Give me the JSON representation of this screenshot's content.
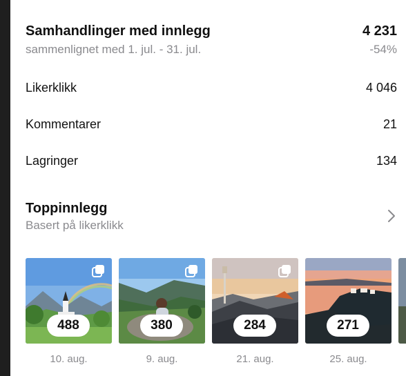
{
  "summary": {
    "title": "Samhandlinger med innlegg",
    "total": "4 231",
    "comparison_text": "sammenlignet med 1. jul. - 31. jul.",
    "change": "-54%"
  },
  "metrics": [
    {
      "label": "Likerklikk",
      "value": "4 046"
    },
    {
      "label": "Kommentarer",
      "value": "21"
    },
    {
      "label": "Lagringer",
      "value": "134"
    }
  ],
  "top_posts": {
    "title": "Toppinnlegg",
    "subtitle": "Basert på likerklikk",
    "chevron_icon": "chevron-right-icon",
    "posts": [
      {
        "count": "488",
        "date": "10. aug.",
        "icon": "carousel-icon"
      },
      {
        "count": "380",
        "date": "9. aug.",
        "icon": "carousel-icon"
      },
      {
        "count": "284",
        "date": "21. aug.",
        "icon": "carousel-icon"
      },
      {
        "count": "271",
        "date": "25. aug.",
        "icon": ""
      }
    ]
  },
  "colors": {
    "text": "#111111",
    "muted": "#8a8a8e",
    "background": "#ffffff",
    "edge": "#1f1f1f"
  }
}
